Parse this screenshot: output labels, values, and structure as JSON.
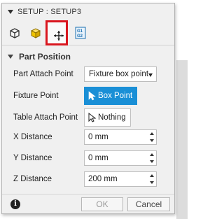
{
  "title": "SETUP : SETUP3",
  "tabs": [
    {
      "icon": "stock-box-outline-icon"
    },
    {
      "icon": "stock-box-solid-icon"
    },
    {
      "icon": "move-arrows-icon",
      "active": true
    },
    {
      "icon": "wcs-table-icon"
    }
  ],
  "section": {
    "title": "Part Position"
  },
  "fields": {
    "part_attach_point": {
      "label": "Part Attach Point",
      "value": "Fixture box point"
    },
    "fixture_point": {
      "label": "Fixture Point",
      "value": "Box Point"
    },
    "table_attach_point": {
      "label": "Table Attach Point",
      "value": "Nothing"
    },
    "x_distance": {
      "label": "X Distance",
      "value": "0 mm"
    },
    "y_distance": {
      "label": "Y Distance",
      "value": "0 mm"
    },
    "z_distance": {
      "label": "Z Distance",
      "value": "200 mm"
    }
  },
  "footer": {
    "ok_label": "OK",
    "cancel_label": "Cancel",
    "info_icon": "i"
  },
  "colors": {
    "accent": "#1a8fd6",
    "active_tab_border": "#d9161e"
  }
}
